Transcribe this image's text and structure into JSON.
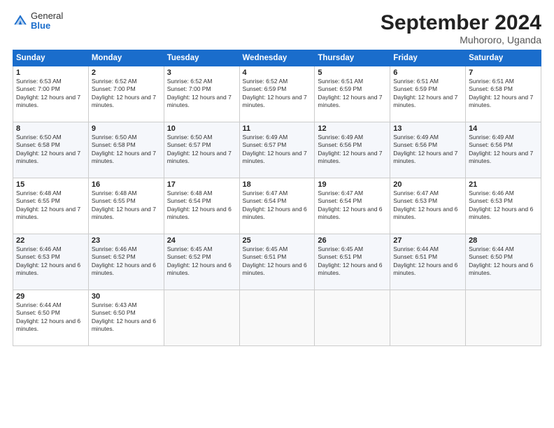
{
  "logo": {
    "general": "General",
    "blue": "Blue"
  },
  "title": "September 2024",
  "location": "Muhororo, Uganda",
  "headers": [
    "Sunday",
    "Monday",
    "Tuesday",
    "Wednesday",
    "Thursday",
    "Friday",
    "Saturday"
  ],
  "weeks": [
    [
      {
        "day": "1",
        "sunrise": "6:53 AM",
        "sunset": "7:00 PM",
        "daylight": "12 hours and 7 minutes."
      },
      {
        "day": "2",
        "sunrise": "6:52 AM",
        "sunset": "7:00 PM",
        "daylight": "12 hours and 7 minutes."
      },
      {
        "day": "3",
        "sunrise": "6:52 AM",
        "sunset": "7:00 PM",
        "daylight": "12 hours and 7 minutes."
      },
      {
        "day": "4",
        "sunrise": "6:52 AM",
        "sunset": "6:59 PM",
        "daylight": "12 hours and 7 minutes."
      },
      {
        "day": "5",
        "sunrise": "6:51 AM",
        "sunset": "6:59 PM",
        "daylight": "12 hours and 7 minutes."
      },
      {
        "day": "6",
        "sunrise": "6:51 AM",
        "sunset": "6:59 PM",
        "daylight": "12 hours and 7 minutes."
      },
      {
        "day": "7",
        "sunrise": "6:51 AM",
        "sunset": "6:58 PM",
        "daylight": "12 hours and 7 minutes."
      }
    ],
    [
      {
        "day": "8",
        "sunrise": "6:50 AM",
        "sunset": "6:58 PM",
        "daylight": "12 hours and 7 minutes."
      },
      {
        "day": "9",
        "sunrise": "6:50 AM",
        "sunset": "6:58 PM",
        "daylight": "12 hours and 7 minutes."
      },
      {
        "day": "10",
        "sunrise": "6:50 AM",
        "sunset": "6:57 PM",
        "daylight": "12 hours and 7 minutes."
      },
      {
        "day": "11",
        "sunrise": "6:49 AM",
        "sunset": "6:57 PM",
        "daylight": "12 hours and 7 minutes."
      },
      {
        "day": "12",
        "sunrise": "6:49 AM",
        "sunset": "6:56 PM",
        "daylight": "12 hours and 7 minutes."
      },
      {
        "day": "13",
        "sunrise": "6:49 AM",
        "sunset": "6:56 PM",
        "daylight": "12 hours and 7 minutes."
      },
      {
        "day": "14",
        "sunrise": "6:49 AM",
        "sunset": "6:56 PM",
        "daylight": "12 hours and 7 minutes."
      }
    ],
    [
      {
        "day": "15",
        "sunrise": "6:48 AM",
        "sunset": "6:55 PM",
        "daylight": "12 hours and 7 minutes."
      },
      {
        "day": "16",
        "sunrise": "6:48 AM",
        "sunset": "6:55 PM",
        "daylight": "12 hours and 7 minutes."
      },
      {
        "day": "17",
        "sunrise": "6:48 AM",
        "sunset": "6:54 PM",
        "daylight": "12 hours and 6 minutes."
      },
      {
        "day": "18",
        "sunrise": "6:47 AM",
        "sunset": "6:54 PM",
        "daylight": "12 hours and 6 minutes."
      },
      {
        "day": "19",
        "sunrise": "6:47 AM",
        "sunset": "6:54 PM",
        "daylight": "12 hours and 6 minutes."
      },
      {
        "day": "20",
        "sunrise": "6:47 AM",
        "sunset": "6:53 PM",
        "daylight": "12 hours and 6 minutes."
      },
      {
        "day": "21",
        "sunrise": "6:46 AM",
        "sunset": "6:53 PM",
        "daylight": "12 hours and 6 minutes."
      }
    ],
    [
      {
        "day": "22",
        "sunrise": "6:46 AM",
        "sunset": "6:53 PM",
        "daylight": "12 hours and 6 minutes."
      },
      {
        "day": "23",
        "sunrise": "6:46 AM",
        "sunset": "6:52 PM",
        "daylight": "12 hours and 6 minutes."
      },
      {
        "day": "24",
        "sunrise": "6:45 AM",
        "sunset": "6:52 PM",
        "daylight": "12 hours and 6 minutes."
      },
      {
        "day": "25",
        "sunrise": "6:45 AM",
        "sunset": "6:51 PM",
        "daylight": "12 hours and 6 minutes."
      },
      {
        "day": "26",
        "sunrise": "6:45 AM",
        "sunset": "6:51 PM",
        "daylight": "12 hours and 6 minutes."
      },
      {
        "day": "27",
        "sunrise": "6:44 AM",
        "sunset": "6:51 PM",
        "daylight": "12 hours and 6 minutes."
      },
      {
        "day": "28",
        "sunrise": "6:44 AM",
        "sunset": "6:50 PM",
        "daylight": "12 hours and 6 minutes."
      }
    ],
    [
      {
        "day": "29",
        "sunrise": "6:44 AM",
        "sunset": "6:50 PM",
        "daylight": "12 hours and 6 minutes."
      },
      {
        "day": "30",
        "sunrise": "6:43 AM",
        "sunset": "6:50 PM",
        "daylight": "12 hours and 6 minutes."
      },
      null,
      null,
      null,
      null,
      null
    ]
  ],
  "labels": {
    "sunrise": "Sunrise:",
    "sunset": "Sunset:",
    "daylight": "Daylight:"
  }
}
